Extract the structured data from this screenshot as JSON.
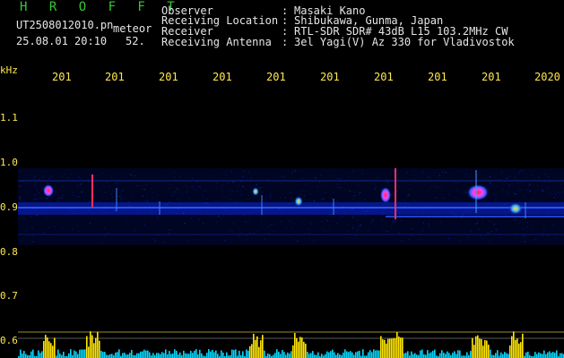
{
  "header": {
    "title": "H R O F F T",
    "filename": "UT2508012010.pn",
    "mode": "meteor",
    "datetime": "25.08.01 20:10",
    "count": "52."
  },
  "info": [
    {
      "label": "Observer",
      "value": "Masaki Kano"
    },
    {
      "label": "Receiving Location",
      "value": "Shibukawa, Gunma, Japan"
    },
    {
      "label": "Receiver",
      "value": "RTL-SDR SDR# 43dB L15 103.2MHz CW"
    },
    {
      "label": "Receiving Antenna",
      "value": "3el Yagi(V) Az 330 for Vladivostok"
    }
  ],
  "time_ticks": [
    "201",
    "201",
    "201",
    "201",
    "201",
    "201",
    "201",
    "201",
    "201",
    "2020"
  ],
  "freq_axis": {
    "unit": "kHz",
    "labels": [
      "1.1",
      "1.0",
      "0.9",
      "0.8",
      "0.7",
      "0.6"
    ]
  },
  "colors": {
    "background": "#000000",
    "title": "#34c934",
    "text": "#e6e6e6",
    "axis": "#ffe94d",
    "noise": "#1a33ff",
    "signal_hot": "#ff2a2a",
    "bars_yellow": "#ffe600",
    "bars_cyan": "#00d8ff"
  }
}
